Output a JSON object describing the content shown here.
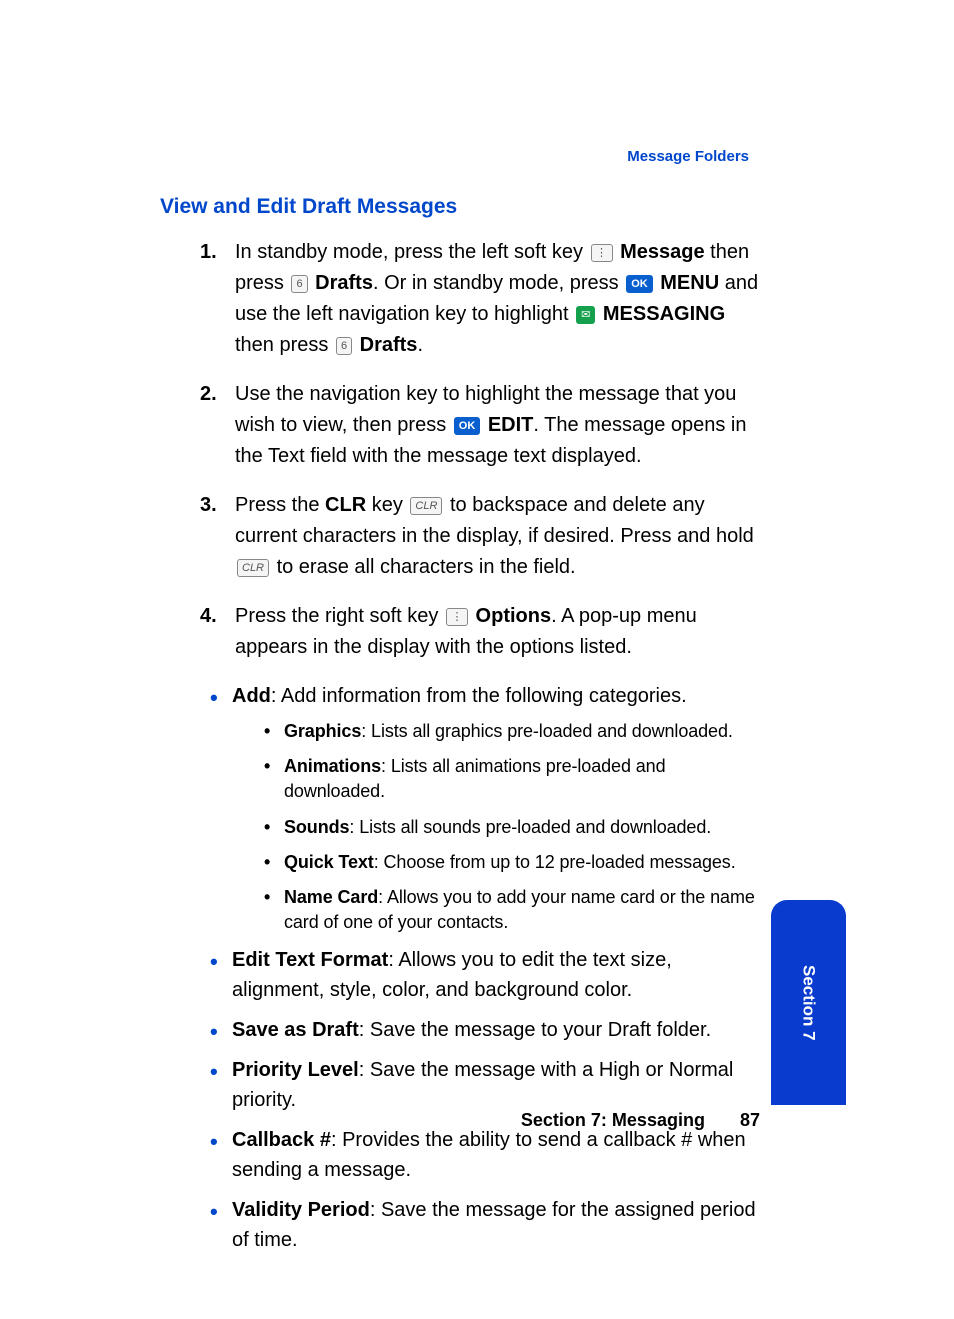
{
  "header": {
    "breadcrumb": "Message Folders"
  },
  "section_title": "View and Edit Draft Messages",
  "steps": {
    "s1": {
      "t1": "In standby mode, press the left soft key ",
      "k1_label": "⋮",
      "t2": " Message",
      "t3": " then press ",
      "k2_label": "6",
      "t4": " Drafts",
      "t5": ". Or in standby mode, press ",
      "k3_label": "OK",
      "t6": " MENU",
      "t7": " and use the left navigation key to highlight ",
      "k4_label": "✉",
      "t8": " MESSAGING",
      "t9": " then press ",
      "k5_label": "6",
      "t10": " Drafts",
      "t11": "."
    },
    "s2": {
      "t1": "Use the navigation key to highlight the message that you wish to view, then press ",
      "k1_label": "OK",
      "t2": " EDIT",
      "t3": ". The message opens in the Text field with the message text displayed."
    },
    "s3": {
      "t1": "Press the ",
      "t1b": "CLR",
      "t2": " key ",
      "k1_label": "CLR",
      "t3": " to backspace and delete any current characters in the display, if desired. Press and hold ",
      "k2_label": "CLR",
      "t4": " to erase all characters in the field."
    },
    "s4": {
      "t1": "Press the right soft key ",
      "k1_label": "⋮",
      "t2": " Options",
      "t3": ". A pop-up menu appears in the display with the options listed."
    }
  },
  "options": {
    "add": {
      "title": "Add",
      "desc": ": Add information from the following categories.",
      "sub": {
        "graphics": {
          "title": "Graphics",
          "desc": ": Lists all graphics pre-loaded and downloaded."
        },
        "animations": {
          "title": "Animations",
          "desc": ": Lists all animations pre-loaded and downloaded."
        },
        "sounds": {
          "title": "Sounds",
          "desc": ": Lists all sounds pre-loaded and downloaded."
        },
        "quick_text": {
          "title": "Quick Text",
          "desc": ": Choose from up to 12 pre-loaded messages."
        },
        "name_card": {
          "title": "Name Card",
          "desc": ": Allows you to add your name card or the name card of one of your contacts."
        }
      }
    },
    "edit_text_format": {
      "title": "Edit Text Format",
      "desc": ": Allows you to edit the text size, alignment, style, color, and background color."
    },
    "save_as_draft": {
      "title": "Save as Draft",
      "desc": ": Save the message to your Draft folder."
    },
    "priority_level": {
      "title": "Priority Level",
      "desc": ": Save the message with a High or Normal priority."
    },
    "callback": {
      "title": "Callback #",
      "desc": ": Provides the ability to send a callback # when sending a message."
    },
    "validity_period": {
      "title": "Validity Period",
      "desc": ": Save the message for the assigned period of time."
    }
  },
  "footer": {
    "section_label": "Section 7: Messaging",
    "page_number": "87"
  },
  "side_tab": {
    "label": "Section 7"
  }
}
